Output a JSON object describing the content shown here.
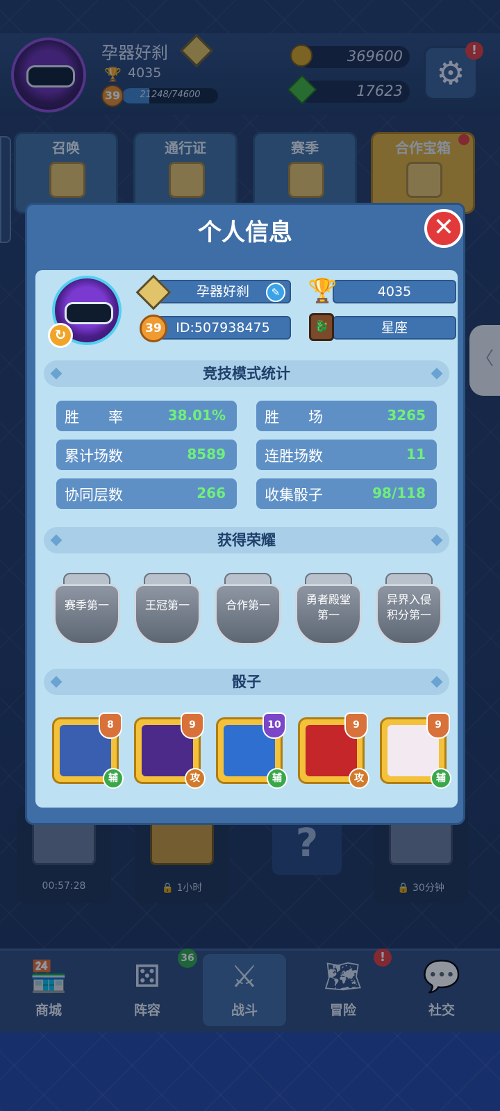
{
  "topbar": {
    "player_name": "孕器好刹",
    "trophies": "4035",
    "level": "39",
    "xp_text": "21248/74600",
    "xp_progress": 0.285,
    "gold": "369600",
    "gems": "17623",
    "settings_alert": "!"
  },
  "tiles": [
    {
      "label": "召唤"
    },
    {
      "label": "通行证"
    },
    {
      "label": "赛季"
    },
    {
      "label": "合作宝箱"
    }
  ],
  "side_handle": "〈",
  "chests": [
    {
      "time": "00:57:28"
    },
    {
      "time": "🔒 1小时"
    },
    {
      "time": "🔒 30分钟"
    }
  ],
  "mystery_box": "?",
  "nav": {
    "badge_lineup": "36",
    "alert_adventure": "!",
    "items": [
      {
        "label": "商城",
        "icon": "shop-icon"
      },
      {
        "label": "阵容",
        "icon": "dice-icon"
      },
      {
        "label": "战斗",
        "icon": "crossed-swords-icon"
      },
      {
        "label": "冒险",
        "icon": "adventure-icon"
      },
      {
        "label": "社交",
        "icon": "chat-bubbles-icon"
      }
    ]
  },
  "modal": {
    "title": "个人信息",
    "close": "✕",
    "profile": {
      "name": "孕器好刹",
      "trophies": "4035",
      "level": "39",
      "id": "ID:507938475",
      "constellation": "星座"
    },
    "sections": {
      "stats": "竞技模式统计",
      "honors": "获得荣耀",
      "dice": "骰子"
    },
    "stats": [
      {
        "label": "胜　　率",
        "value": "38.01%"
      },
      {
        "label": "胜　　场",
        "value": "3265"
      },
      {
        "label": "累计场数",
        "value": "8589"
      },
      {
        "label": "连胜场数",
        "value": "11"
      },
      {
        "label": "协同层数",
        "value": "266"
      },
      {
        "label": "收集骰子",
        "value": "98/118"
      }
    ],
    "honors": [
      {
        "line1": "赛季第一",
        "line2": ""
      },
      {
        "line1": "王冠第一",
        "line2": ""
      },
      {
        "line1": "合作第一",
        "line2": ""
      },
      {
        "line1": "勇者殿堂",
        "line2": "第一"
      },
      {
        "line1": "异界入侵",
        "line2": "积分第一"
      }
    ],
    "dice": [
      {
        "level": "8",
        "tag": "辅",
        "face_color": "#3a5fb0"
      },
      {
        "level": "9",
        "tag": "攻",
        "face_color": "#4b2a8a"
      },
      {
        "level": "10",
        "tag": "辅",
        "face_color": "#2f6fd0"
      },
      {
        "level": "9",
        "tag": "攻",
        "face_color": "#c4262a"
      },
      {
        "level": "9",
        "tag": "辅",
        "face_color": "#f3e9f1"
      }
    ]
  },
  "colors": {
    "accent_green": "#6ff07a",
    "panel_bg": "#bde0f3",
    "close_red": "#e23a3a"
  }
}
